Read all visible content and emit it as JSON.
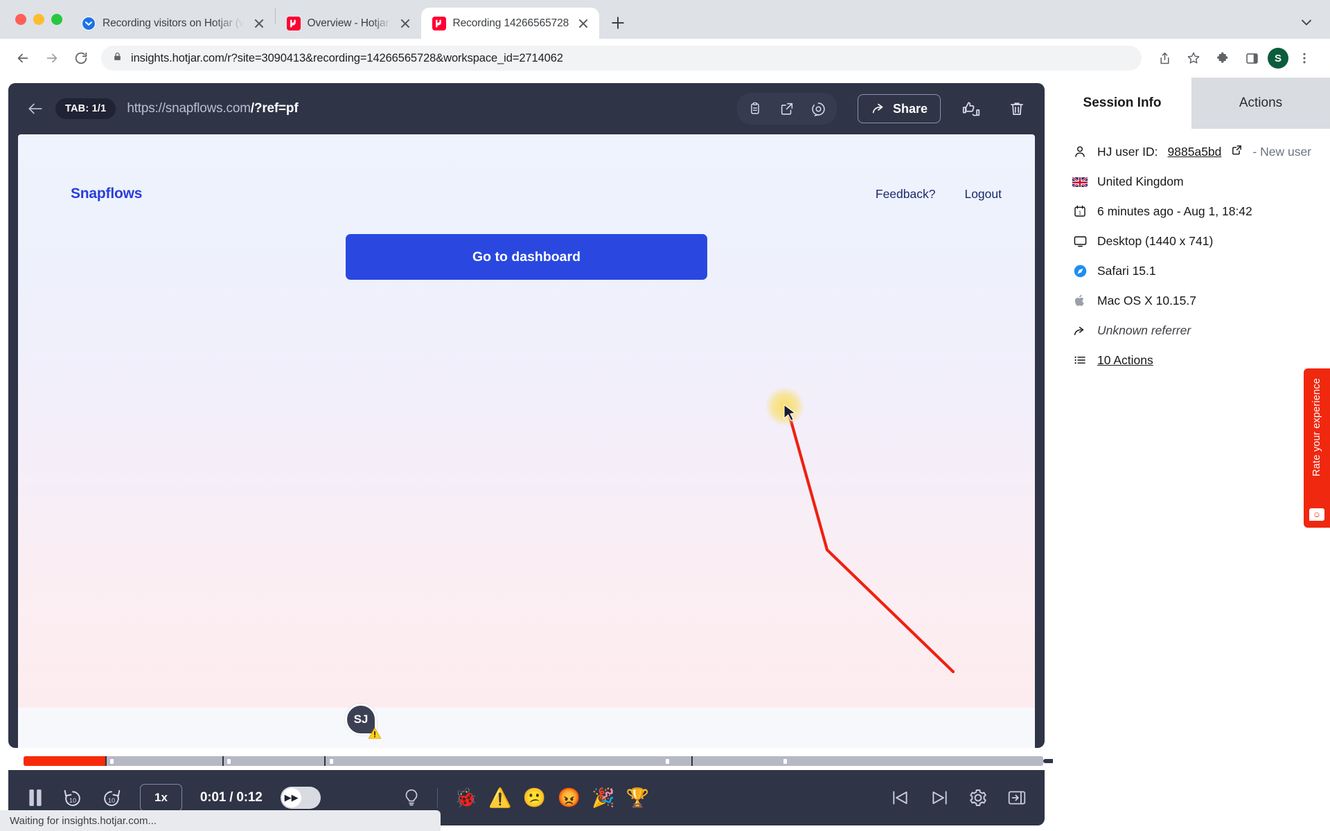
{
  "browser": {
    "tabs": [
      {
        "title": "Recording visitors on Hotjar (v",
        "favicon": "pocket-icon",
        "active": false
      },
      {
        "title": "Overview - Hotjar",
        "favicon": "hotjar-icon",
        "active": false
      },
      {
        "title": "Recording 14266565728",
        "favicon": "hotjar-icon",
        "active": true
      }
    ],
    "new_tab_label": "+",
    "url": "insights.hotjar.com/r?site=3090413&recording=14266565728&workspace_id=2714062",
    "profile_initial": "S",
    "toolbar_icons": [
      "back-icon",
      "forward-icon",
      "reload-icon",
      "lock-icon",
      "share-icon",
      "bookmark-star-icon",
      "extensions-puzzle-icon",
      "side-panel-icon",
      "profile-avatar",
      "three-dot-menu-icon"
    ]
  },
  "player": {
    "tab_pill": "TAB: 1/1",
    "url_prefix": "https://snapflows.com",
    "url_suffix": "/?ref=pf",
    "share_label": "Share",
    "head_icons": [
      "copy-icon",
      "open-external-icon",
      "highlight-icon",
      "feedback-thumbs-icon",
      "delete-trash-icon"
    ]
  },
  "site": {
    "brand": "Snapflows",
    "links": [
      "Feedback?",
      "Logout"
    ],
    "cta_label": "Go to dashboard",
    "visitor_initials": "SJ"
  },
  "controls": {
    "play_state": "pause-icon",
    "rewind_label": "10",
    "forward_label": "10",
    "speed": "1x",
    "time": "0:01 / 0:12",
    "skip_toggle": "skip-inactivity-toggle",
    "reactions": [
      "bug",
      "warning",
      "confused",
      "angry",
      "party",
      "trophy"
    ],
    "reaction_glyphs": [
      "🐞",
      "⚠️",
      "😕",
      "😡",
      "🎉",
      "🏆"
    ],
    "right_icons": [
      "skip-previous-icon",
      "skip-next-icon",
      "settings-gear-icon",
      "collapse-panel-icon"
    ],
    "progress_percent": 8
  },
  "sidebar": {
    "tabs": [
      {
        "label": "Session Info",
        "selected": true
      },
      {
        "label": "Actions",
        "selected": false
      }
    ],
    "info": [
      {
        "icon": "user-icon",
        "label": "HJ user ID:",
        "value": "9885a5bd",
        "suffix": "- New user",
        "link": true
      },
      {
        "icon": "uk-flag-icon",
        "label": "United Kingdom"
      },
      {
        "icon": "calendar-icon",
        "label": "6 minutes ago - Aug 1, 18:42"
      },
      {
        "icon": "desktop-icon",
        "label": "Desktop (1440 x 741)"
      },
      {
        "icon": "safari-icon",
        "label": "Safari 15.1"
      },
      {
        "icon": "apple-icon",
        "label": "Mac OS X 10.15.7"
      },
      {
        "icon": "referrer-arrow-icon",
        "label": "Unknown referrer",
        "italic": true
      },
      {
        "icon": "list-icon",
        "label": "10 Actions",
        "link": true
      }
    ]
  },
  "rate_widget": {
    "text": "Rate your experience",
    "icon": "smiley-card-icon"
  },
  "status_bar": {
    "text": "Waiting for insights.hotjar.com..."
  },
  "colors": {
    "hotjar_red": "#f0280f",
    "player_bg": "#2f3447",
    "cta_blue": "#2a48e0",
    "progress_red": "#f72b0a",
    "profile_green": "#0b5d3b"
  }
}
